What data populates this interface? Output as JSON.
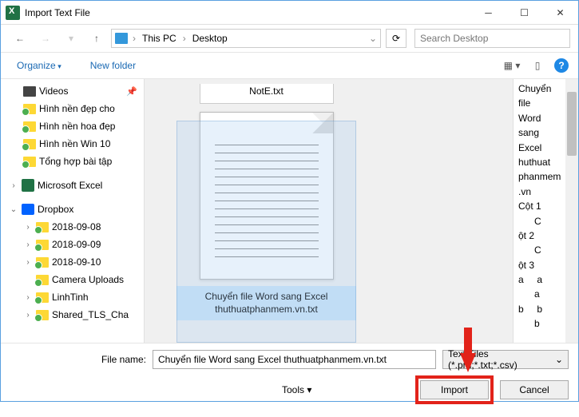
{
  "window": {
    "title": "Import Text File"
  },
  "nav": {
    "breadcrumb": {
      "root": "This PC",
      "current": "Desktop"
    },
    "search_placeholder": "Search Desktop"
  },
  "toolbar": {
    "organize": "Organize",
    "new_folder": "New folder"
  },
  "sidebar": {
    "videos": "Videos",
    "items": [
      "Hình nền đẹp cho",
      "Hình nền hoa đẹp",
      "Hình nền Win 10",
      "Tổng hợp bài tập"
    ],
    "excel": "Microsoft Excel",
    "dropbox": "Dropbox",
    "dropbox_items": [
      "2018-09-08",
      "2018-09-09",
      "2018-09-10",
      "Camera Uploads",
      "LinhTinh",
      "Shared_TLS_Cha"
    ]
  },
  "files": {
    "note": "NotE.txt",
    "selected_caption_l1": "Chuyển file Word sang Excel",
    "selected_caption_l2": "thuthuatphanmem.vn.txt"
  },
  "preview_text": "Chuyển\nfile\nWord\nsang\nExcel\nhuthuat\nphanmem\n.vn\nCột 1\n      C\nột 2\n      C\nột 3\na     a\n      a\nb     b\n      b",
  "footer": {
    "filename_label": "File name:",
    "filename_value": "Chuyển file Word sang Excel thuthuatphanmem.vn.txt",
    "filetype": "Text Files (*.prn;*.txt;*.csv)",
    "tools": "Tools",
    "import": "Import",
    "cancel": "Cancel"
  }
}
